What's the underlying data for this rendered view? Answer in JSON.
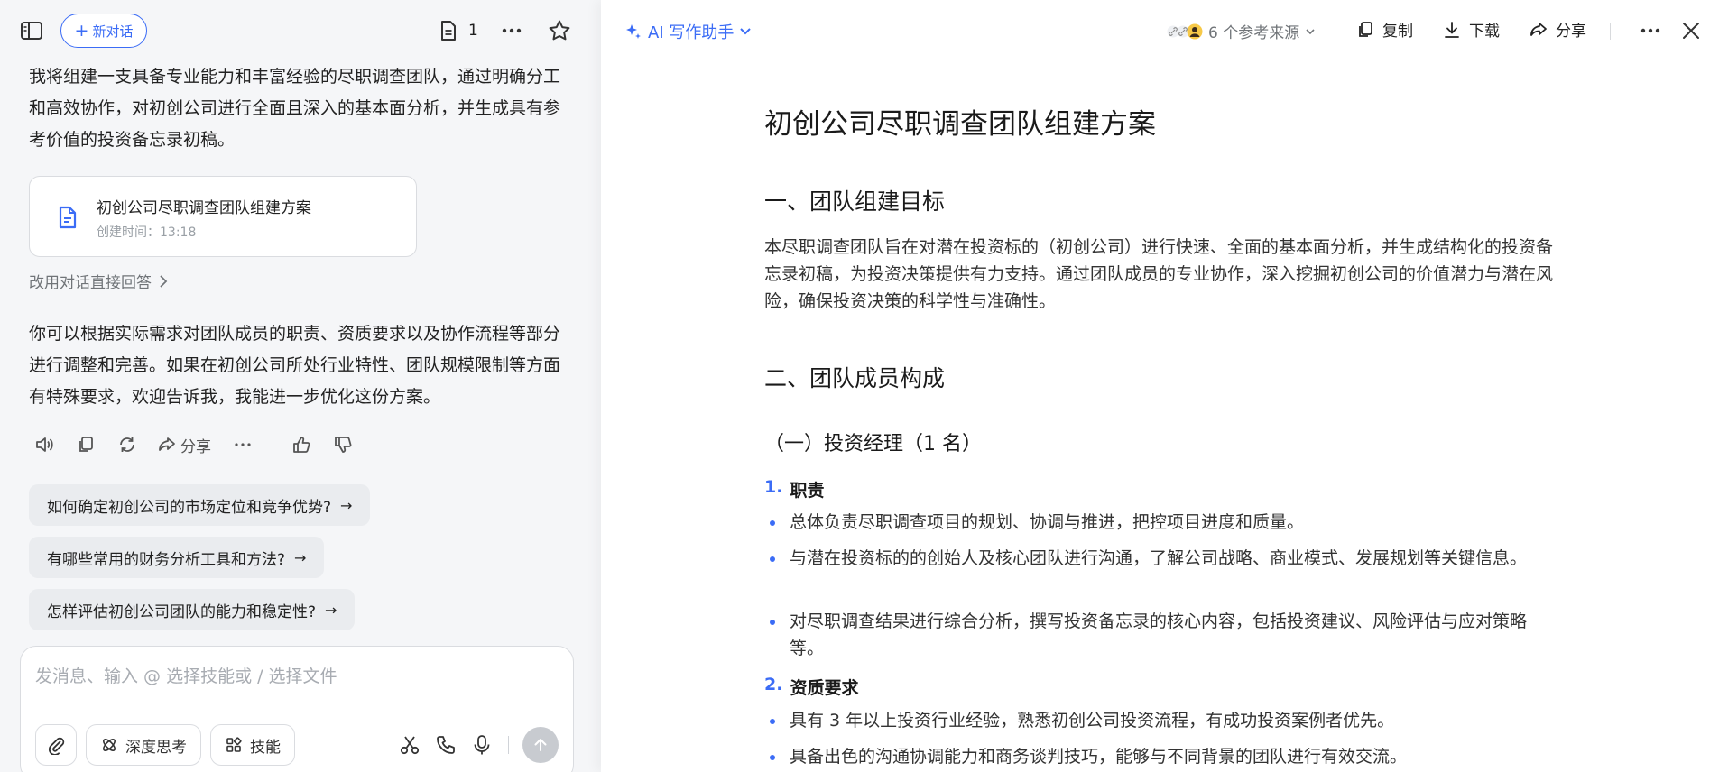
{
  "left": {
    "new_chat_label": "新对话",
    "doc_count": "1",
    "message1": "我将组建一支具备专业能力和丰富经验的尽职调查团队，通过明确分工和高效协作，对初创公司进行全面且深入的基本面分析，并生成具有参考价值的投资备忘录初稿。",
    "doc_card": {
      "title": "初创公司尽职调查团队组建方案",
      "time": "创建时间：13:18"
    },
    "switch_link": "改用对话直接回答",
    "message2": "你可以根据实际需求对团队成员的职责、资质要求以及协作流程等部分进行调整和完善。如果在初创公司所处行业特性、团队规模限制等方面有特殊要求，欢迎告诉我，我能进一步优化这份方案。",
    "share_label": "分享",
    "suggestions": [
      "如何确定初创公司的市场定位和竞争优势?",
      "有哪些常用的财务分析工具和方法?",
      "怎样评估初创公司团队的能力和稳定性?"
    ],
    "input": {
      "placeholder": "发消息、输入 @ 选择技能或 / 选择文件",
      "value": "",
      "think_label": "深度思考",
      "skill_label": "技能"
    }
  },
  "right": {
    "ai_helper_label": "AI 写作助手",
    "refs_label": "6 个参考来源",
    "copy_label": "复制",
    "download_label": "下载",
    "share_label": "分享",
    "doc": {
      "title": "初创公司尽职调查团队组建方案",
      "section1_title": "一、团队组建目标",
      "section1_text": "本尽职调查团队旨在对潜在投资标的（初创公司）进行快速、全面的基本面分析，并生成结构化的投资备忘录初稿，为投资决策提供有力支持。通过团队成员的专业协作，深入挖掘初创公司的价值潜力与潜在风险，确保投资决策的科学性与准确性。",
      "section2_title": "二、团队成员构成",
      "sub1_title": "（一）投资经理（1 名）",
      "ol1": {
        "num": "1.",
        "label": "职责"
      },
      "duties": [
        "总体负责尽职调查项目的规划、协调与推进，把控项目进度和质量。",
        "与潜在投资标的的创始人及核心团队进行沟通，了解公司战略、商业模式、发展规划等关键信息。",
        "对尽职调查结果进行综合分析，撰写投资备忘录的核心内容，包括投资建议、风险评估与应对策略等。"
      ],
      "ol2": {
        "num": "2.",
        "label": "资质要求"
      },
      "quals": [
        "具有 3 年以上投资行业经验，熟悉初创公司投资流程，有成功投资案例者优先。",
        "具备出色的沟通协调能力和商务谈判技巧，能够与不同背景的团队进行有效交流。"
      ]
    }
  },
  "colors": {
    "accent": "#3b6cf6",
    "left_bg": "#f5f6f8"
  }
}
